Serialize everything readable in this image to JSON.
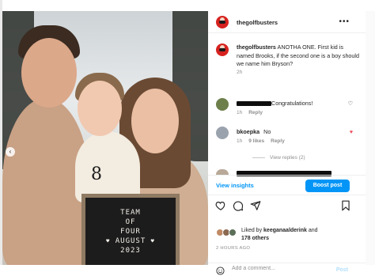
{
  "post": {
    "username": "thegolfbusters",
    "more_label": "•••",
    "sign": {
      "lines": [
        "TEAM",
        "OF",
        "FOUR",
        "AUGUST",
        "2023"
      ],
      "hearts": "♥"
    }
  },
  "caption": {
    "username": "thegolfbusters",
    "text": "ANOTHA ONE. First kid is named Brooks, if the second one is a boy should we name him Bryson?",
    "time": "2h"
  },
  "comments": [
    {
      "username": "",
      "text": "Congratulations!",
      "time": "1h",
      "reply": "Reply",
      "liked": false
    },
    {
      "username": "bkoepka",
      "text": "No",
      "time": "1h",
      "likes": "9 likes",
      "reply": "Reply",
      "liked": true
    }
  ],
  "view_replies": "View replies (2)",
  "actions": {
    "view_insights": "View insights",
    "boost": "Boost post"
  },
  "likes": {
    "prefix": "Liked by",
    "user": "keeganaalderink",
    "connector": "and",
    "others": "178 others"
  },
  "timestamp": "2 HOURS AGO",
  "add_comment": {
    "placeholder": "Add a comment...",
    "post_label": "Post"
  },
  "colors": {
    "accent": "#0095f6",
    "heart_red": "#ed4956",
    "muted": "#8e8e8e"
  },
  "icons": [
    "chevron-left-icon",
    "more-icon",
    "heart-icon",
    "comment-icon",
    "share-icon",
    "bookmark-icon",
    "emoji-icon"
  ]
}
